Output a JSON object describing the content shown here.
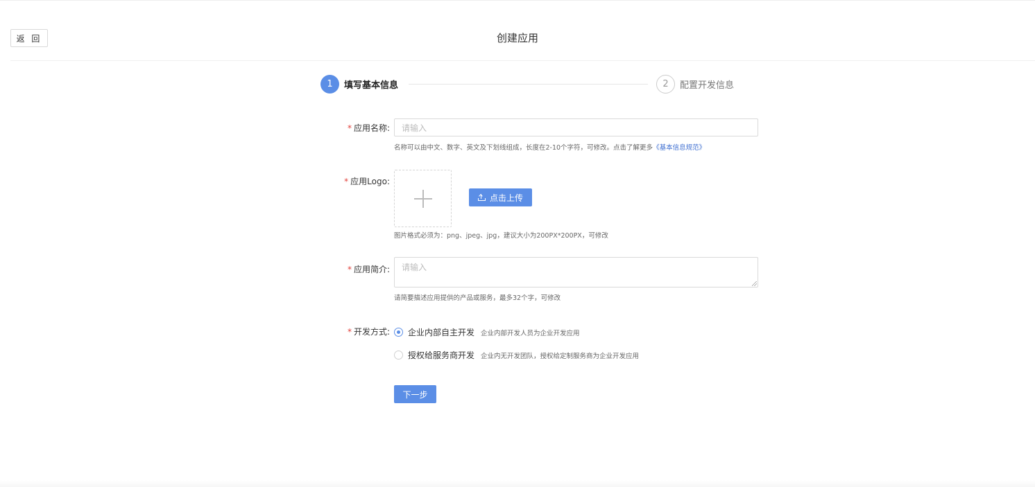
{
  "header": {
    "back_label": "返 回",
    "title": "创建应用"
  },
  "steps": [
    {
      "number": "1",
      "label": "填写基本信息",
      "state": "active"
    },
    {
      "number": "2",
      "label": "配置开发信息",
      "state": "pending"
    }
  ],
  "form": {
    "app_name": {
      "label": "应用名称:",
      "placeholder": "请输入",
      "hint": "名称可以由中文、数字、英文及下划线组成，长度在2-10个字符，可修改。点击了解更多",
      "hint_link": "《基本信息规范》"
    },
    "app_logo": {
      "label": "应用Logo:",
      "upload_button": "点击上传",
      "hint": "图片格式必须为：png、jpeg、jpg，建议大小为200PX*200PX，可修改"
    },
    "app_intro": {
      "label": "应用简介:",
      "placeholder": "请输入",
      "hint": "请简要描述应用提供的产品或服务，最多32个字，可修改"
    },
    "dev_mode": {
      "label": "开发方式:",
      "options": [
        {
          "label": "企业内部自主开发",
          "desc": "企业内部开发人员为企业开发应用",
          "checked": true
        },
        {
          "label": "授权给服务商开发",
          "desc": "企业内无开发团队，授权给定制服务商为企业开发应用",
          "checked": false
        }
      ]
    },
    "next_button": "下一步"
  },
  "colors": {
    "primary": "#5b8ee6",
    "required": "#e2413b",
    "link": "#3f6fd1"
  }
}
